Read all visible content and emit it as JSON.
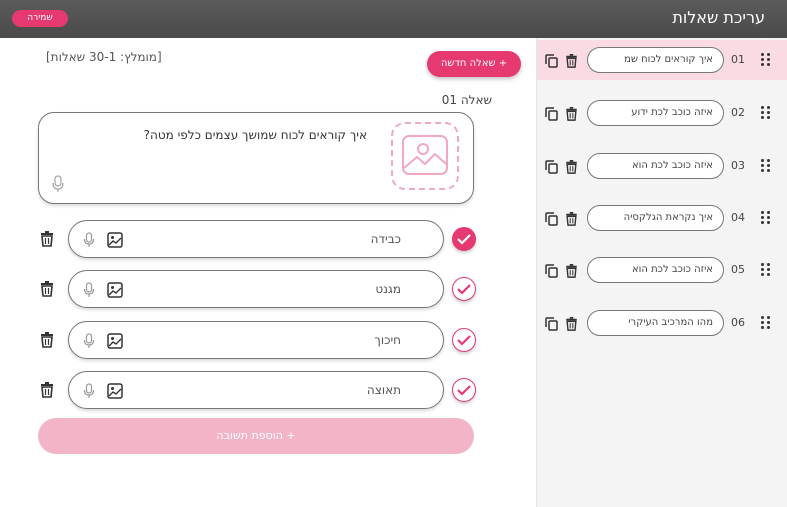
{
  "header": {
    "title": "עריכת שאלות",
    "save_label": "שמירה"
  },
  "main": {
    "hint": "[מומלץ: 30-1 שאלות]",
    "new_question_label": "+ שאלה חדשה",
    "question_label": "שאלה 01",
    "question_text": "איך קוראים לכוח שמושך עצמים כלפי מטה?",
    "answers": [
      {
        "text": "כבידה",
        "correct": true
      },
      {
        "text": "מגנט",
        "correct": false
      },
      {
        "text": "חיכוך",
        "correct": false
      },
      {
        "text": "תאוצה",
        "correct": false
      }
    ],
    "add_answer_label": "+ הוספת תשובה"
  },
  "sidebar": {
    "items": [
      {
        "num": "01",
        "label": "איך קוראים לכוח שמ",
        "active": true
      },
      {
        "num": "02",
        "label": "איזה כוכב לכת ידוע",
        "active": false
      },
      {
        "num": "03",
        "label": "איזה כוכב לכת הוא",
        "active": false
      },
      {
        "num": "04",
        "label": "איך נקראת הגלקסיה",
        "active": false
      },
      {
        "num": "05",
        "label": "איזה כוכב לכת הוא",
        "active": false
      },
      {
        "num": "06",
        "label": "מהו המרכיב העיקרי",
        "active": false
      }
    ]
  },
  "colors": {
    "accent": "#e6396f",
    "accent_light": "#f4b4c7",
    "active_row": "#fadbe3",
    "topbar": "#505050"
  }
}
